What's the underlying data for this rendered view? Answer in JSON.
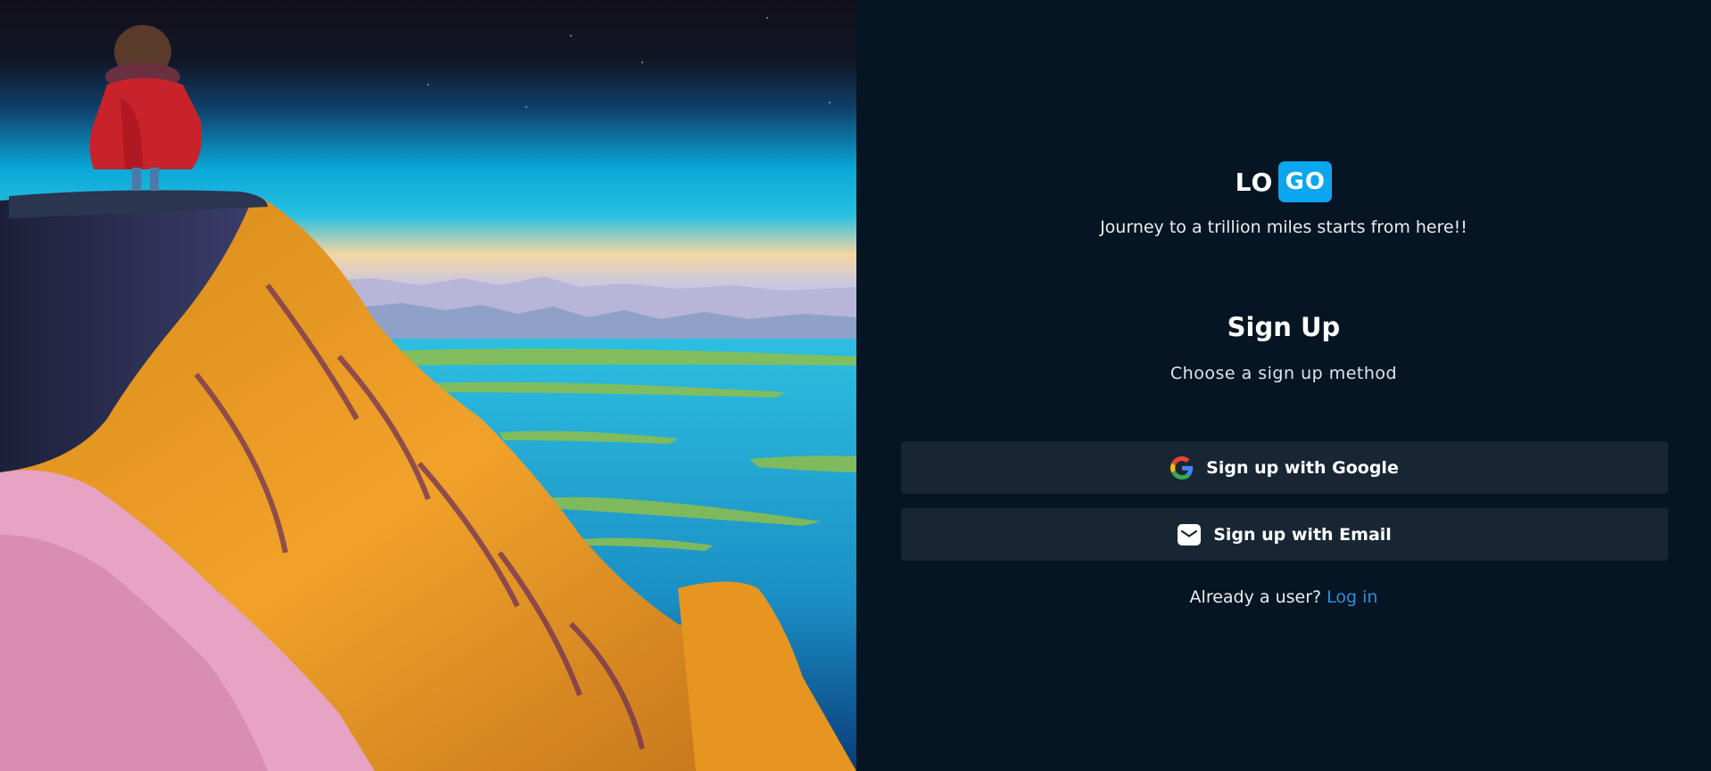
{
  "brand": {
    "logo_left": "LO",
    "logo_right": "GO",
    "tagline": "Journey to a trillion miles starts from here!!"
  },
  "auth": {
    "title": "Sign Up",
    "subtitle": "Choose a sign up method",
    "google_button": {
      "label": "Sign up with Google",
      "icon": "google-icon"
    },
    "email_button": {
      "label": "Sign up with Email",
      "icon": "mail-icon"
    },
    "footer_text": "Already a user?",
    "login_link": "Log in"
  },
  "colors": {
    "background": "#061523",
    "button": "#182633",
    "accent": "#0aa6ef",
    "link": "#2b8fe0"
  }
}
